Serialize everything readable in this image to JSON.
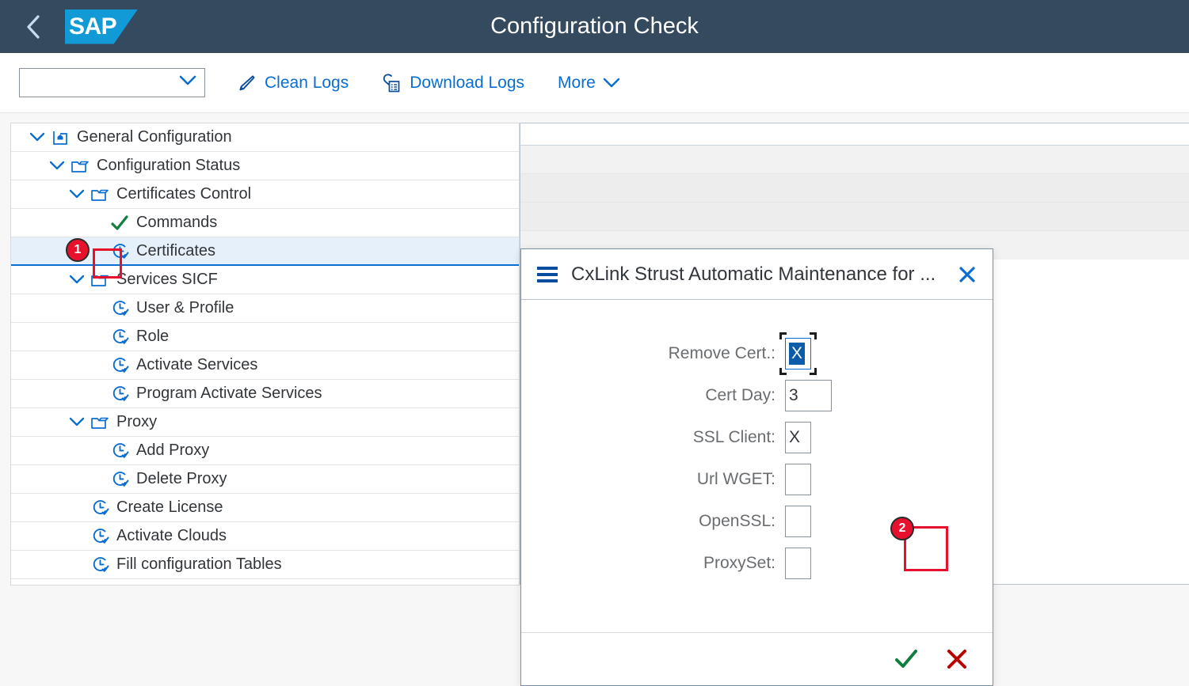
{
  "shell": {
    "back_icon": "chevron-left-icon",
    "logo_text": "SAP",
    "title": "Configuration Check"
  },
  "toolbar": {
    "select_value": "",
    "select_placeholder": "",
    "clean_logs_label": "Clean Logs",
    "clean_logs_icon": "pencil-icon",
    "download_logs_label": "Download Logs",
    "download_logs_icon": "attachment-icon",
    "more_label": "More",
    "more_icon": "chevron-down-icon"
  },
  "tree": {
    "items": [
      {
        "label": "General Configuration",
        "level": 0,
        "expanded": true,
        "icon": "home-folder-icon",
        "selected": false
      },
      {
        "label": "Configuration Status",
        "level": 1,
        "expanded": true,
        "icon": "folder-icon",
        "selected": false
      },
      {
        "label": "Certificates Control",
        "level": 2,
        "expanded": true,
        "icon": "folder-icon",
        "selected": false
      },
      {
        "label": "Commands",
        "level": 3,
        "expanded": null,
        "icon": "check-icon",
        "selected": false
      },
      {
        "label": "Certificates",
        "level": 3,
        "expanded": null,
        "icon": "pending-clock-icon",
        "selected": true
      },
      {
        "label": "Services SICF",
        "level": 2,
        "expanded": true,
        "icon": "folder-icon",
        "selected": false
      },
      {
        "label": "User & Profile",
        "level": 3,
        "expanded": null,
        "icon": "pending-clock-icon",
        "selected": false
      },
      {
        "label": "Role",
        "level": 3,
        "expanded": null,
        "icon": "pending-clock-icon",
        "selected": false
      },
      {
        "label": "Activate Services",
        "level": 3,
        "expanded": null,
        "icon": "pending-clock-icon",
        "selected": false
      },
      {
        "label": "Program Activate Services",
        "level": 3,
        "expanded": null,
        "icon": "pending-clock-icon",
        "selected": false
      },
      {
        "label": "Proxy",
        "level": 2,
        "expanded": true,
        "icon": "folder-icon",
        "selected": false
      },
      {
        "label": "Add Proxy",
        "level": 3,
        "expanded": null,
        "icon": "pending-clock-icon",
        "selected": false
      },
      {
        "label": "Delete Proxy",
        "level": 3,
        "expanded": null,
        "icon": "pending-clock-icon",
        "selected": false
      },
      {
        "label": "Create License",
        "level": 2,
        "expanded": null,
        "icon": "pending-clock-icon",
        "selected": false
      },
      {
        "label": "Activate Clouds",
        "level": 2,
        "expanded": null,
        "icon": "pending-clock-icon",
        "selected": false
      },
      {
        "label": "Fill configuration Tables",
        "level": 2,
        "expanded": null,
        "icon": "pending-clock-icon",
        "selected": false
      }
    ]
  },
  "dialog": {
    "title": "CxLink Strust Automatic Maintenance for ...",
    "menu_icon": "hamburger-menu-icon",
    "close_icon": "close-x-icon",
    "fields": [
      {
        "label": "Remove Cert.:",
        "value": "X",
        "focused": true,
        "wide": false
      },
      {
        "label": "Cert Day:",
        "value": "3",
        "focused": false,
        "wide": true
      },
      {
        "label": "SSL Client:",
        "value": "X",
        "focused": false,
        "wide": false
      },
      {
        "label": "Url WGET:",
        "value": "",
        "focused": false,
        "wide": false
      },
      {
        "label": "OpenSSL:",
        "value": "",
        "focused": false,
        "wide": false
      },
      {
        "label": "ProxySet:",
        "value": "",
        "focused": false,
        "wide": false
      }
    ],
    "confirm_icon": "green-check-icon",
    "cancel_icon": "red-x-icon"
  },
  "annotations": [
    {
      "number": "1",
      "target": "certificates-tree-icon"
    },
    {
      "number": "2",
      "target": "dialog-confirm-button"
    }
  ],
  "colors": {
    "shell_bg": "#354a5f",
    "accent_blue": "#0a6ed1",
    "logo_blue": "#129ad6",
    "annotation_red": "#e8112d",
    "success_green": "#107e3e",
    "error_red": "#bb0000",
    "selected_row": "#e5f0fa"
  }
}
